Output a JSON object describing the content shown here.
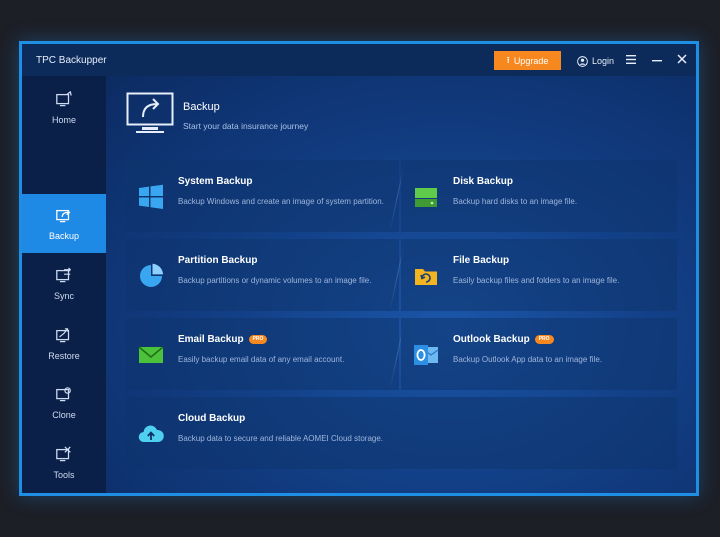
{
  "app": {
    "title": "TPC Backupper"
  },
  "titlebar": {
    "upgrade_label": "Upgrade",
    "login_label": "Login",
    "menu_icon": "hamburger-icon",
    "minimize_icon": "minimize-icon",
    "close_icon": "close-icon"
  },
  "sidebar": {
    "items": [
      {
        "label": "Home",
        "icon": "home-monitor-icon",
        "active": false
      },
      {
        "label": "Backup",
        "icon": "backup-arrow-icon",
        "active": true
      },
      {
        "label": "Sync",
        "icon": "sync-icon",
        "active": false
      },
      {
        "label": "Restore",
        "icon": "restore-icon",
        "active": false
      },
      {
        "label": "Clone",
        "icon": "clone-icon",
        "active": false
      },
      {
        "label": "Tools",
        "icon": "tools-icon",
        "active": false
      }
    ]
  },
  "main": {
    "header": {
      "title": "Backup",
      "subtitle": "Start your data insurance journey"
    },
    "cards": [
      {
        "title": "System Backup",
        "desc": "Backup Windows and create an image of system partition.",
        "icon": "windows-icon",
        "pro": false
      },
      {
        "title": "Disk Backup",
        "desc": "Backup hard disks to an image file.",
        "icon": "disk-icon",
        "pro": false
      },
      {
        "title": "Partition Backup",
        "desc": "Backup partitions or dynamic volumes to an image file.",
        "icon": "pie-chart-icon",
        "pro": false
      },
      {
        "title": "File Backup",
        "desc": "Easily backup files and folders to an image file.",
        "icon": "folder-sync-icon",
        "pro": false
      },
      {
        "title": "Email Backup",
        "desc": "Easily backup email data of any email account.",
        "icon": "email-icon",
        "pro": true,
        "badge": "PRO"
      },
      {
        "title": "Outlook Backup",
        "desc": "Backup Outlook App data to an image file.",
        "icon": "outlook-icon",
        "pro": true,
        "badge": "PRO"
      },
      {
        "title": "Cloud Backup",
        "desc": "Backup data to secure and reliable AOMEI Cloud storage.",
        "icon": "cloud-upload-icon",
        "pro": false
      }
    ]
  },
  "colors": {
    "accent": "#1f8ae6",
    "upgrade": "#f7881f",
    "background": "#0b2350"
  }
}
